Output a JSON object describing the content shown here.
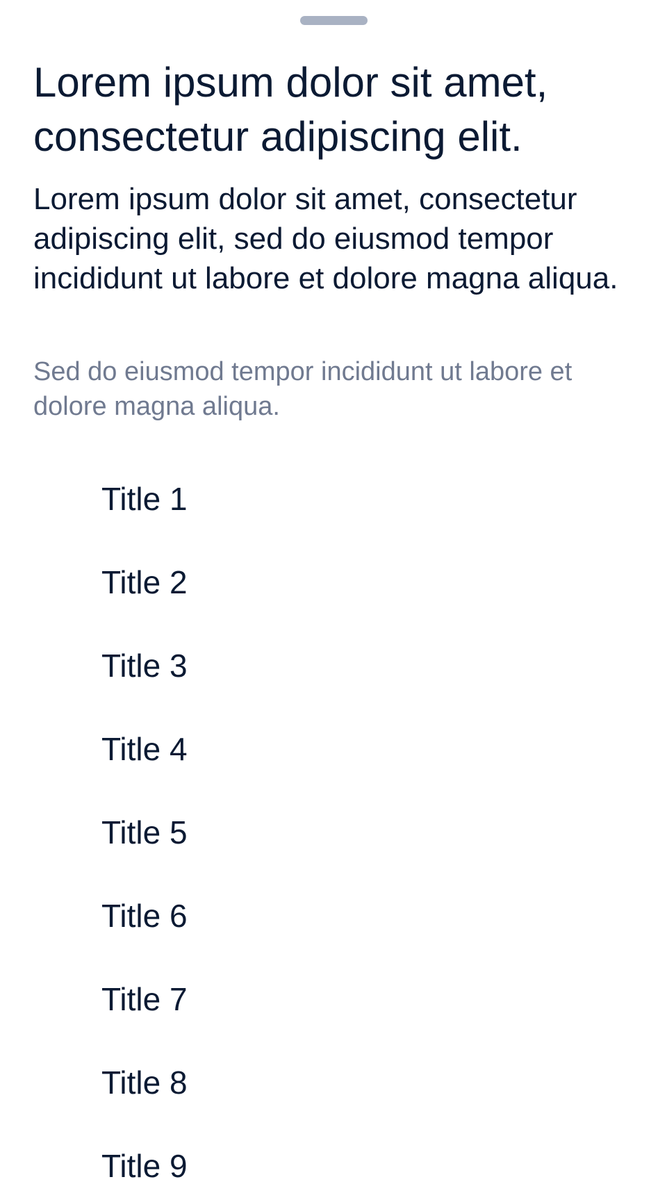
{
  "sheet": {
    "title": "Lorem ipsum dolor sit amet, consectetur adipiscing elit.",
    "body": "Lorem ipsum dolor sit amet, consectetur adipiscing elit, sed do eiusmod tempor incididunt ut labore et dolore magna aliqua.",
    "secondary": "Sed do eiusmod tempor incididunt ut labore et dolore magna aliqua."
  },
  "list": {
    "items": [
      {
        "label": "Title 1"
      },
      {
        "label": "Title 2"
      },
      {
        "label": "Title 3"
      },
      {
        "label": "Title 4"
      },
      {
        "label": "Title 5"
      },
      {
        "label": "Title 6"
      },
      {
        "label": "Title 7"
      },
      {
        "label": "Title 8"
      },
      {
        "label": "Title 9"
      }
    ]
  },
  "colors": {
    "primary_text": "#0b1a33",
    "secondary_text": "#707a90",
    "grabber": "#a9b2c3",
    "background": "#ffffff"
  }
}
